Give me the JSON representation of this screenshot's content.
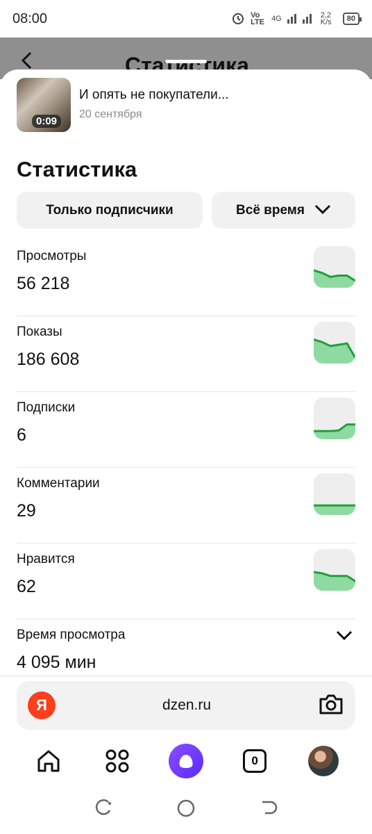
{
  "status_bar": {
    "time": "08:00",
    "network": "4G",
    "volte": "Vo LTE",
    "speed": "2,2 K/s",
    "battery": "80"
  },
  "background_page": {
    "title": "Статистика",
    "back_icon": "chevron-left-icon"
  },
  "post": {
    "title": "И опять не покупатели...",
    "date": "20 сентября",
    "duration": "0:09"
  },
  "sheet": {
    "title": "Статистика",
    "filter_audience": "Только подписчики",
    "filter_period": "Всё время"
  },
  "metrics": [
    {
      "label": "Просмотры",
      "value": "56 218",
      "trend": [
        0.45,
        0.35,
        0.2,
        0.25,
        0.25,
        0.05
      ]
    },
    {
      "label": "Показы",
      "value": "186 608",
      "trend": [
        0.7,
        0.6,
        0.45,
        0.5,
        0.55,
        0.0
      ]
    },
    {
      "label": "Подписки",
      "value": "6",
      "trend": [
        0.1,
        0.1,
        0.1,
        0.12,
        0.35,
        0.35
      ]
    },
    {
      "label": "Комментарии",
      "value": "29",
      "trend": [
        0.15,
        0.15,
        0.15,
        0.15,
        0.15,
        0.15
      ]
    },
    {
      "label": "Нравится",
      "value": "62",
      "trend": [
        0.5,
        0.45,
        0.35,
        0.35,
        0.35,
        0.15
      ]
    },
    {
      "label": "Время просмотра",
      "value": "4 095 мин"
    }
  ],
  "browser": {
    "logo_letter": "Я",
    "url": "dzen.ru",
    "camera_icon": "camera-icon"
  },
  "bottom_nav": {
    "tabs_count": "0"
  },
  "colors": {
    "accent_green": "#21a038",
    "spark_fill": "#8fd9a3",
    "chip_bg": "#f1f1f1",
    "yandex_red": "#fc3f1d",
    "alice_purple": "#6e3bff"
  }
}
